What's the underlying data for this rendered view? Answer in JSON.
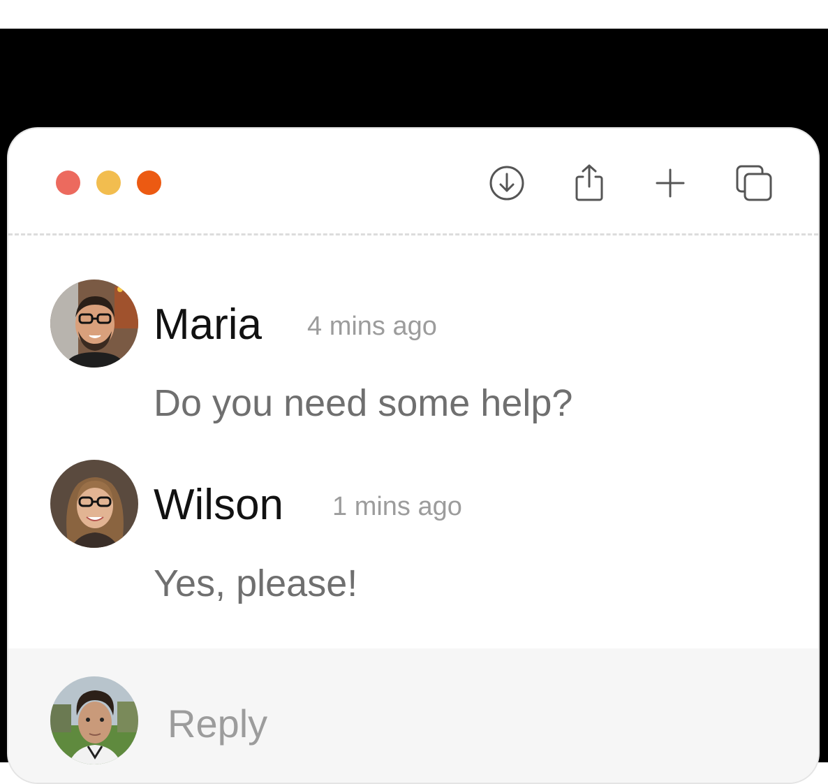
{
  "window": {
    "controls": {
      "close_color": "#ec6a5e",
      "minimize_color": "#f2bd4f",
      "maximize_color": "#ec5a12"
    },
    "toolbar_icons": [
      "download-icon",
      "share-icon",
      "plus-icon",
      "duplicate-icon"
    ]
  },
  "comments": [
    {
      "author": "Maria",
      "time": "4 mins ago",
      "text": "Do you need some help?",
      "avatar": "avatar-man-glasses"
    },
    {
      "author": "Wilson",
      "time": "1 mins ago",
      "text": "Yes, please!",
      "avatar": "avatar-woman-glasses"
    }
  ],
  "reply": {
    "placeholder": "Reply",
    "avatar": "avatar-young-man"
  }
}
